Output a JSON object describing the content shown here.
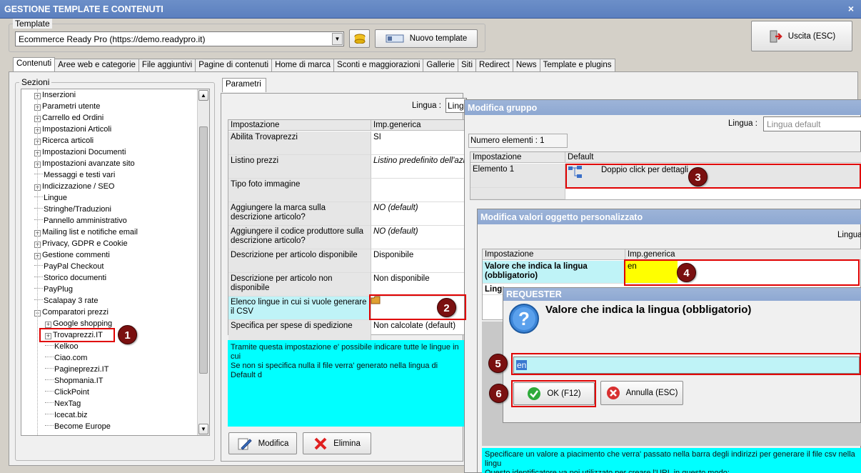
{
  "window": {
    "title": "GESTIONE TEMPLATE E CONTENUTI",
    "close": "×"
  },
  "template": {
    "legend": "Template",
    "selected": "Ecommerce Ready Pro (https://demo.readypro.it)",
    "new_button": "Nuovo template",
    "exit_button": "Uscita (ESC)"
  },
  "tabs": [
    "Contenuti",
    "Aree web e categorie",
    "File aggiuntivi",
    "Pagine di contenuti",
    "Home di marca",
    "Sconti e maggiorazioni",
    "Gallerie",
    "Siti",
    "Redirect",
    "News",
    "Template e plugins"
  ],
  "sections": {
    "legend": "Sezioni",
    "items": [
      {
        "label": "Inserzioni",
        "expand": true,
        "level": 1
      },
      {
        "label": "Parametri utente",
        "expand": true,
        "level": 1
      },
      {
        "label": "Carrello ed Ordini",
        "expand": true,
        "level": 1
      },
      {
        "label": "Impostazioni Articoli",
        "expand": true,
        "level": 1
      },
      {
        "label": "Ricerca articoli",
        "expand": true,
        "level": 1
      },
      {
        "label": "Impostazioni Documenti",
        "expand": true,
        "level": 1
      },
      {
        "label": "Impostazioni avanzate sito",
        "expand": true,
        "level": 1
      },
      {
        "label": "Messaggi e testi vari",
        "expand": false,
        "level": 1
      },
      {
        "label": "Indicizzazione / SEO",
        "expand": true,
        "level": 1
      },
      {
        "label": "Lingue",
        "expand": false,
        "level": 1
      },
      {
        "label": "Stringhe/Traduzioni",
        "expand": false,
        "level": 1
      },
      {
        "label": "Pannello amministrativo",
        "expand": false,
        "level": 1
      },
      {
        "label": "Mailing list e notifiche email",
        "expand": true,
        "level": 1
      },
      {
        "label": "Privacy, GDPR e Cookie",
        "expand": true,
        "level": 1
      },
      {
        "label": "Gestione commenti",
        "expand": true,
        "level": 1
      },
      {
        "label": "PayPal Checkout",
        "expand": false,
        "level": 1
      },
      {
        "label": "Storico documenti",
        "expand": false,
        "level": 1
      },
      {
        "label": "PayPlug",
        "expand": false,
        "level": 1
      },
      {
        "label": "Scalapay 3 rate",
        "expand": false,
        "level": 1
      },
      {
        "label": "Comparatori prezzi",
        "expand": "minus",
        "level": 1
      },
      {
        "label": "Google shopping",
        "expand": true,
        "level": 2
      },
      {
        "label": "Trovaprezzi.IT",
        "expand": true,
        "level": 2
      },
      {
        "label": "Kelkoo",
        "expand": false,
        "level": 2
      },
      {
        "label": "Ciao.com",
        "expand": false,
        "level": 2
      },
      {
        "label": "Pagineprezzi.IT",
        "expand": false,
        "level": 2
      },
      {
        "label": "Shopmania.IT",
        "expand": false,
        "level": 2
      },
      {
        "label": "ClickPoint",
        "expand": false,
        "level": 2
      },
      {
        "label": "NexTag",
        "expand": false,
        "level": 2
      },
      {
        "label": "Icecat.biz",
        "expand": false,
        "level": 2
      },
      {
        "label": "Become Europe",
        "expand": false,
        "level": 2
      }
    ]
  },
  "params": {
    "tab": "Parametri",
    "lingua_label": "Lingua :",
    "lingua_value": "Lingu",
    "col_setting": "Impostazione",
    "col_value": "Imp.generica",
    "rows": [
      {
        "label": "Abilita Trovaprezzi",
        "value": "SI"
      },
      {
        "label": "Listino prezzi",
        "value": "Listino predefinito dell'azie"
      },
      {
        "label": "Tipo foto immagine",
        "value": ""
      },
      {
        "label": "Aggiungere la marca sulla descrizione articolo?",
        "value": "NO (default)"
      },
      {
        "label": "Aggiungere il codice produttore sulla descrizione articolo?",
        "value": "NO (default)"
      },
      {
        "label": "Descrizione per articolo disponibile",
        "value": "Disponibile"
      },
      {
        "label": "Descrizione per articolo non disponibile",
        "value": "Non disponibile"
      },
      {
        "label": "Elenco lingue in cui si vuole generare il CSV",
        "value": ""
      },
      {
        "label": "Specifica per spese di spedizione",
        "value": "Non calcolate (default)"
      }
    ],
    "help": "Tramite questa impostazione e' possibile indicare tutte le lingue in cui\nSe non si specifica nulla il file verra' generato nella lingua di Default d",
    "edit_button": "Modifica",
    "delete_button": "Elimina"
  },
  "group_dialog": {
    "title": "Modifica gruppo",
    "lingua_label": "Lingua :",
    "lingua_value": "Lingua default",
    "count": "Numero elementi : 1",
    "col_setting": "Impostazione",
    "col_default": "Default",
    "row_label": "Elemento 1",
    "row_value": "Doppio click per dettagli"
  },
  "custom_dialog": {
    "title": "Modifica valori oggetto personalizzato",
    "lingua_label": "Lingua",
    "col_setting": "Impostazione",
    "col_value": "Imp.generica",
    "row_label": "Valore che indica la lingua (obbligatorio)",
    "row_value": "en",
    "row2_label": "Lingu",
    "help": "Specificare un valore a piacimento che verra' passato nella barra degli indirizzi per generare il file csv nella lingu\nQuesto identificatore va poi utilizzato per creare l'URL in questo modo:\nEs.: l'identificatore dell'URL per il file in lingua ingl"
  },
  "requester": {
    "title": "REQUESTER",
    "question": "Valore che indica la lingua (obbligatorio)",
    "input_value": "en",
    "ok_button": "OK (F12)",
    "cancel_button": "Annulla (ESC)"
  },
  "badges": [
    "1",
    "2",
    "3",
    "4",
    "5",
    "6"
  ],
  "colors": {
    "highlight_red": "#e00000",
    "badge": "#7a1010",
    "cyan": "#00ffff",
    "yellow": "#ffff00",
    "title": "#5b7fbf"
  }
}
